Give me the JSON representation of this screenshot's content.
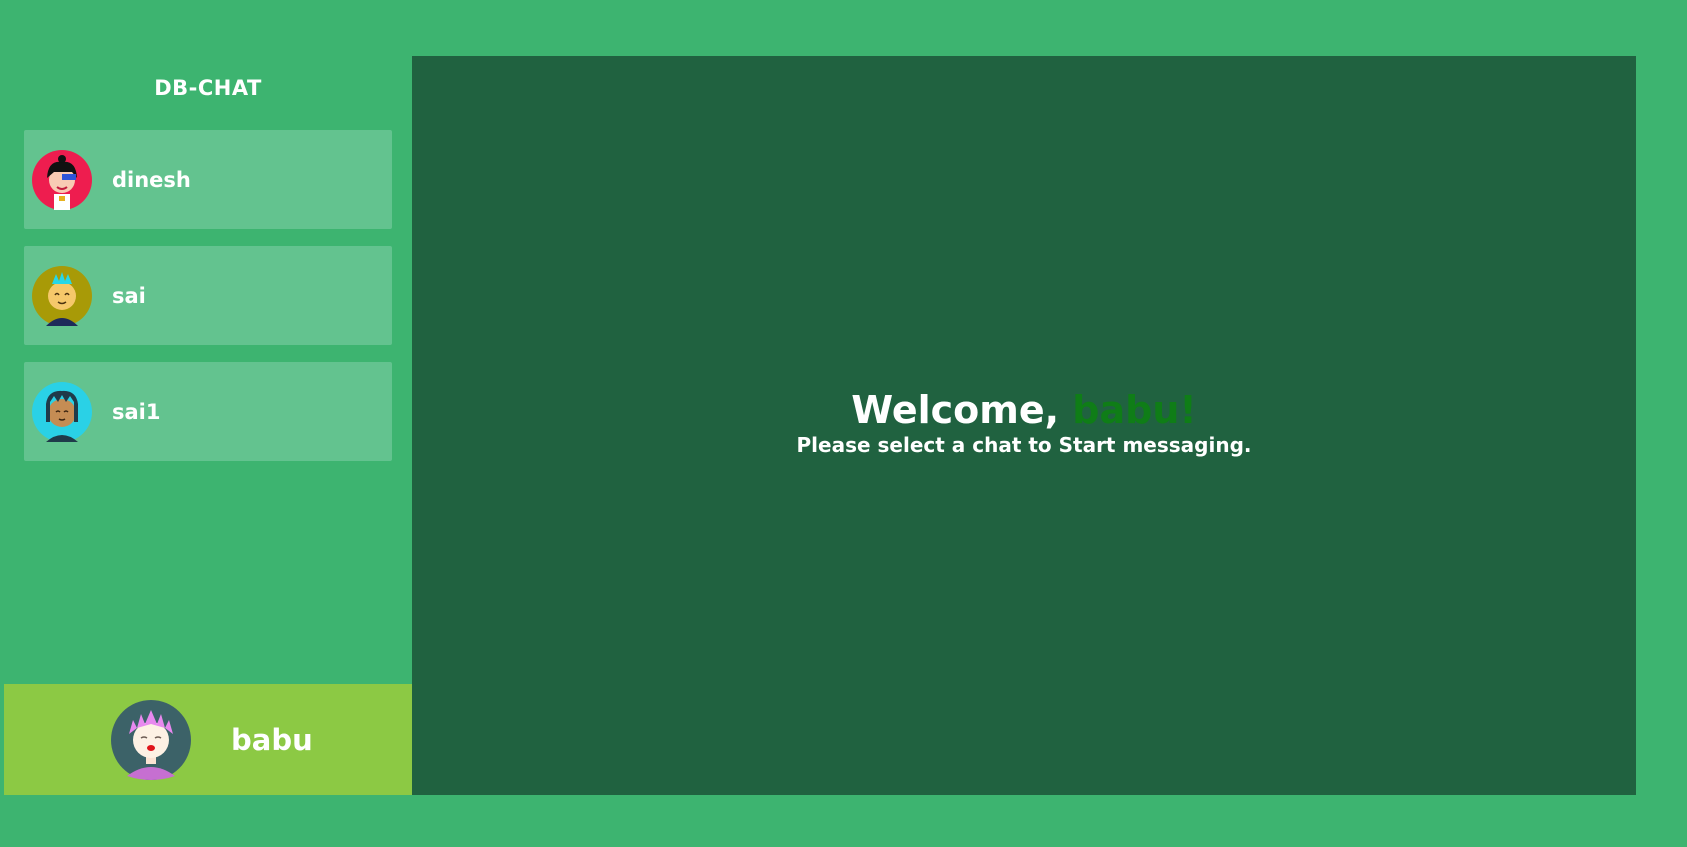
{
  "app": {
    "title": "DB-CHAT"
  },
  "contacts": [
    {
      "name": "dinesh",
      "avatar": "avatar-dinesh-icon"
    },
    {
      "name": "sai",
      "avatar": "avatar-sai-icon"
    },
    {
      "name": "sai1",
      "avatar": "avatar-sai1-icon"
    }
  ],
  "current_user": {
    "name": "babu",
    "avatar": "avatar-babu-icon"
  },
  "main": {
    "welcome_prefix": "Welcome, ",
    "welcome_name": "babu!",
    "subtitle": "Please select a chat to Start messaging."
  },
  "colors": {
    "background": "#3db470",
    "contact_card": "#63c38f",
    "profile_bar": "#8cc944",
    "main_panel": "#206240",
    "welcome_name": "#0f7d17"
  }
}
